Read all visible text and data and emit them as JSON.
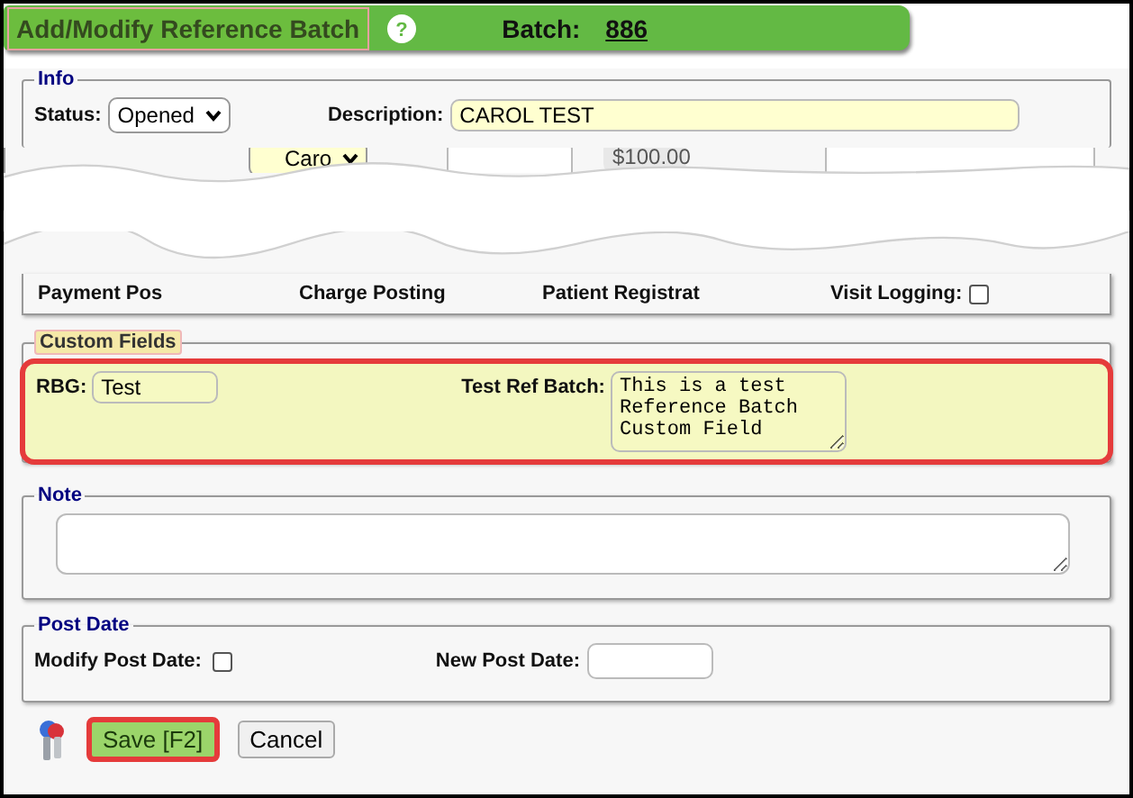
{
  "header": {
    "title": "Add/Modify Reference Batch",
    "help": "?",
    "batch_label": "Batch:",
    "batch_number": "886"
  },
  "info": {
    "legend": "Info",
    "status_label": "Status:",
    "status_value": "Opened",
    "description_label": "Description:",
    "description_value": "CAROL TEST",
    "cut_row": [
      {
        "kind": "select",
        "value": "Caro"
      },
      {
        "kind": "input"
      },
      {
        "kind": "amount",
        "value": "$100.00"
      },
      {
        "kind": "input"
      }
    ],
    "flags": [
      {
        "label": "Payment Pos"
      },
      {
        "label": "Charge Posting"
      },
      {
        "label": "Patient Registrat"
      },
      {
        "label": "Visit Logging:",
        "checked": false
      }
    ]
  },
  "custom_fields": {
    "legend": "Custom Fields",
    "fields": [
      {
        "label": "RBG:",
        "kind": "input",
        "value": "Test"
      },
      {
        "label": "Test Ref Batch:",
        "kind": "textarea",
        "value": "This is a test\nReference Batch\nCustom Field"
      }
    ]
  },
  "note": {
    "legend": "Note"
  },
  "post_date": {
    "legend": "Post Date",
    "modify_label": "Modify Post Date:",
    "checked": false,
    "new_label": "New Post Date:"
  },
  "buttons": [
    {
      "label": "Save [F2]",
      "kind": "primary"
    },
    {
      "label": "Cancel",
      "kind": "default"
    }
  ]
}
